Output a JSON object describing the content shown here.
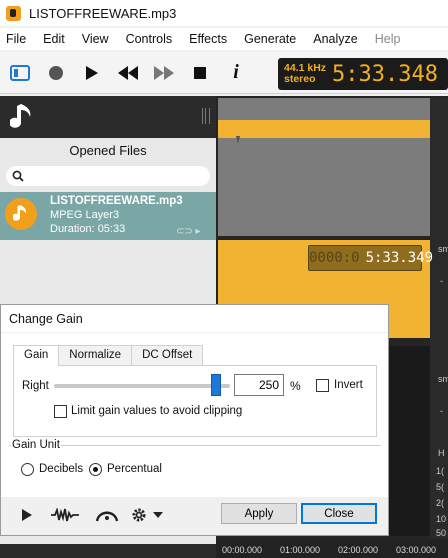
{
  "window": {
    "title": "LISTOFFREEWARE.mp3"
  },
  "menu": [
    "File",
    "Edit",
    "View",
    "Controls",
    "Effects",
    "Generate",
    "Analyze",
    "Help"
  ],
  "toolbar": {
    "icons": [
      "sidebar-toggle-icon",
      "record-icon",
      "play-icon",
      "rewind-icon",
      "fast-forward-icon",
      "stop-icon",
      "info-icon"
    ],
    "info_glyph": "i"
  },
  "lcd": {
    "rate": "44.1 kHz",
    "channels": "stereo",
    "time": "5:33.348"
  },
  "sidebar": {
    "heading": "Opened Files",
    "search_placeholder": "",
    "file": {
      "name": "LISTOFFREEWARE.mp3",
      "format": "MPEG Layer3",
      "duration": "Duration: 05:33",
      "link_glyph": "⊂⊃ ▸"
    }
  },
  "waveform": {
    "badge_ghost": "0000:0",
    "badge_time": "5:33.349",
    "ruler": [
      "00:00.000",
      "01:00.000",
      "02:00.000",
      "03:00.000"
    ],
    "right_labels": [
      "sm",
      "sm",
      "-",
      "-",
      "H",
      "1(",
      "5(",
      "2(",
      "10",
      "50"
    ]
  },
  "dialog": {
    "title": "Change Gain",
    "tabs": [
      "Gain",
      "Normalize",
      "DC Offset"
    ],
    "channel_label": "Right",
    "gain_value": "250",
    "gain_unit_symbol": "%",
    "invert_label": "Invert",
    "limit_label": "Limit gain values to avoid clipping",
    "gain_unit_group": "Gain Unit",
    "units": [
      "Decibels",
      "Percentual"
    ],
    "selected_unit": "Percentual",
    "slider_level": 0.92,
    "apply_label": "Apply",
    "close_label": "Close"
  },
  "colors": {
    "accent": "#f2a01c",
    "selection": "#7aa7a6",
    "slider": "#1e78d6",
    "lcd_text": "#f2b01e"
  }
}
